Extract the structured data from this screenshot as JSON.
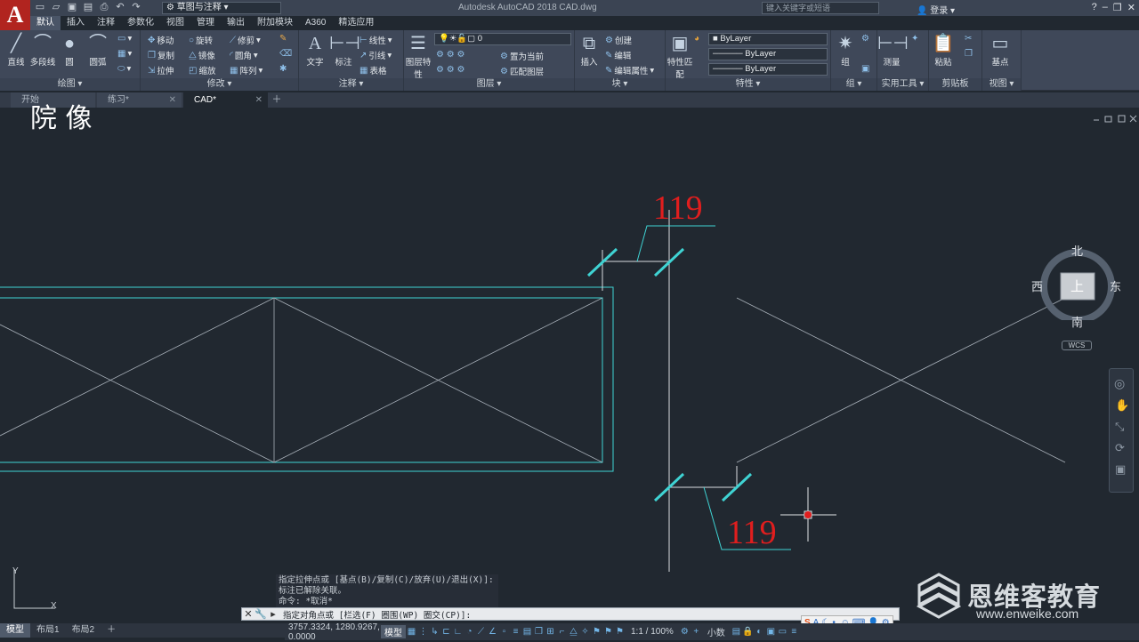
{
  "titlebar": {
    "app_letter": "A",
    "workspace": "草图与注释",
    "title": "Autodesk AutoCAD 2018    CAD.dwg",
    "search_placeholder": "键入关键字或短语",
    "login": "登录"
  },
  "ribbon_tabs": [
    "默认",
    "插入",
    "注释",
    "参数化",
    "视图",
    "管理",
    "输出",
    "附加模块",
    "A360",
    "精选应用"
  ],
  "panels": {
    "draw": {
      "title": "绘图",
      "line": "直线",
      "polyline": "多段线",
      "circle": "圆",
      "arc": "圆弧"
    },
    "modify": {
      "title": "修改",
      "move": "移动",
      "rotate": "旋转",
      "trim": "修剪",
      "copy": "复制",
      "mirror": "镜像",
      "fillet": "圆角",
      "stretch": "拉伸",
      "scale": "缩放",
      "array": "阵列"
    },
    "annotation": {
      "title": "注释",
      "text": "文字",
      "dimension": "标注",
      "linear": "线性",
      "leader": "引线",
      "table": "表格"
    },
    "layers": {
      "title": "图层",
      "layer_props": "图层特性",
      "layer_value": "0",
      "set_current": "置为当前",
      "match_layer": "匹配图层"
    },
    "block": {
      "title": "块",
      "insert": "插入",
      "create": "创建",
      "edit": "编辑",
      "edit_attr": "编辑属性"
    },
    "properties": {
      "title": "特性",
      "match": "特性匹配",
      "color": "ByLayer",
      "linetype": "ByLayer",
      "lineweight": "ByLayer"
    },
    "groups": {
      "title": "组",
      "group": "组"
    },
    "utilities": {
      "title": "实用工具",
      "measure": "测量"
    },
    "clipboard": {
      "title": "剪贴板",
      "paste": "粘贴"
    },
    "view": {
      "title": "视图",
      "base": "基点"
    }
  },
  "file_tabs": [
    {
      "label": "开始",
      "active": false
    },
    {
      "label": "练习*",
      "active": false
    },
    {
      "label": "CAD*",
      "active": true
    }
  ],
  "viewcube": {
    "north": "北",
    "south": "南",
    "east": "东",
    "west": "西",
    "face": "上",
    "wcs": "WCS"
  },
  "drawing": {
    "dim_top": "119",
    "dim_bottom": "119",
    "corner_text": "院 像"
  },
  "command": {
    "history": [
      "指定拉伸点或 [基点(B)/复制(C)/放弃(U)/退出(X)]:",
      "标注已解除关联。",
      "命令: *取消*"
    ],
    "prompt": "指定对角点或 [栏选(F) 圈围(WP) 圈交(CP)]:"
  },
  "layout_tabs": [
    {
      "label": "模型",
      "active": true
    },
    {
      "label": "布局1",
      "active": false
    },
    {
      "label": "布局2",
      "active": false
    }
  ],
  "status": {
    "coords": "3757.3324, 1280.9267, 0.0000",
    "model": "模型",
    "scale": "1:1 / 100%",
    "units": "小数"
  },
  "watermark": {
    "brand": "恩维客教育",
    "url": "www.enweike.com"
  },
  "colors": {
    "accent": "#b1241f",
    "cyan": "#3fd3d3",
    "dim_red": "#e01e1e",
    "canvas": "#212830"
  }
}
